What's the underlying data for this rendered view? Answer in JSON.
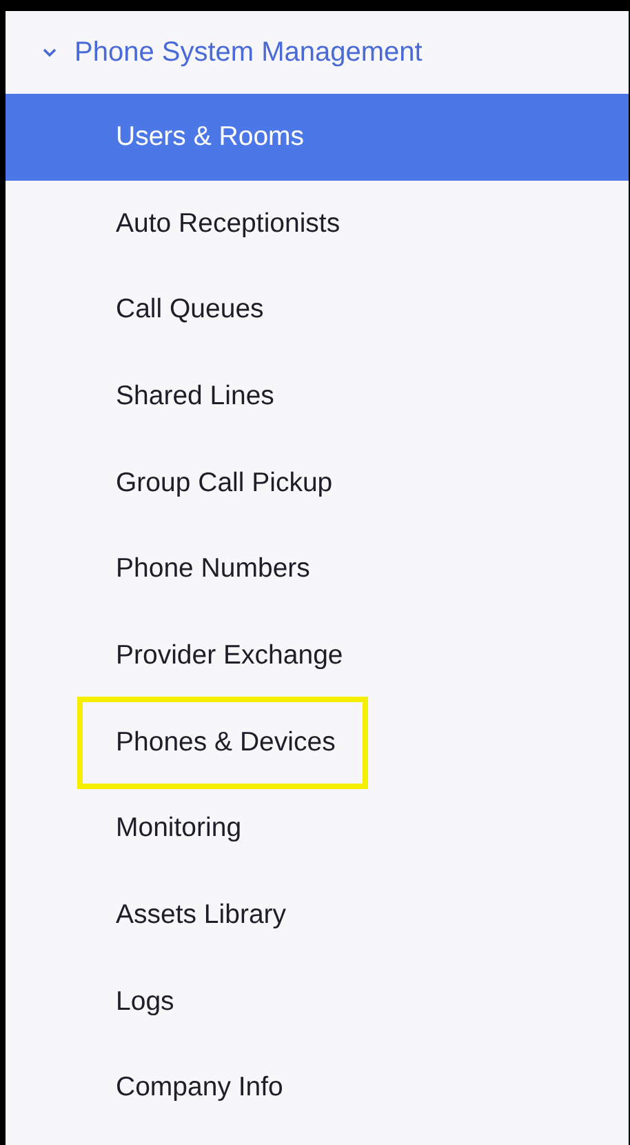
{
  "section": {
    "title": "Phone System Management",
    "expanded": true
  },
  "items": [
    {
      "label": "Users & Rooms",
      "selected": true,
      "highlighted": false
    },
    {
      "label": "Auto Receptionists",
      "selected": false,
      "highlighted": false
    },
    {
      "label": "Call Queues",
      "selected": false,
      "highlighted": false
    },
    {
      "label": "Shared Lines",
      "selected": false,
      "highlighted": false
    },
    {
      "label": "Group Call Pickup",
      "selected": false,
      "highlighted": false
    },
    {
      "label": "Phone Numbers",
      "selected": false,
      "highlighted": false
    },
    {
      "label": "Provider Exchange",
      "selected": false,
      "highlighted": false
    },
    {
      "label": "Phones & Devices",
      "selected": false,
      "highlighted": true
    },
    {
      "label": "Monitoring",
      "selected": false,
      "highlighted": false
    },
    {
      "label": "Assets Library",
      "selected": false,
      "highlighted": false
    },
    {
      "label": "Logs",
      "selected": false,
      "highlighted": false
    },
    {
      "label": "Company Info",
      "selected": false,
      "highlighted": false
    }
  ]
}
